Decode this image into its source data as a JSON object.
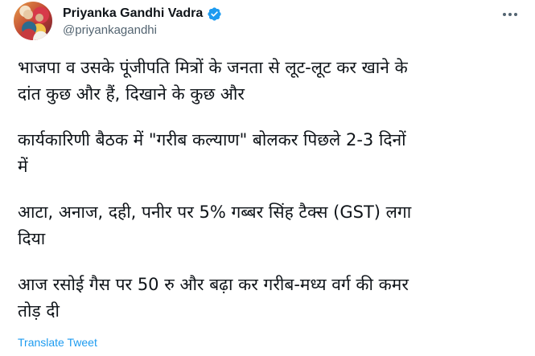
{
  "author": {
    "display_name": "Priyanka Gandhi Vadra",
    "handle": "@priyankagandhi",
    "verified": true,
    "accent_color": "#1d9bf0"
  },
  "tweet": {
    "paragraphs": [
      "भाजपा व उसके पूंजीपति मित्रों के जनता से लूट-लूट कर खाने के\nदांत कुछ और हैं, दिखाने के कुछ और",
      "कार्यकारिणी बैठक में \"गरीब कल्याण\" बोलकर पिछले 2-3 दिनों\nमें",
      "आटा, अनाज, दही, पनीर पर 5% गब्बर सिंह टैक्स (GST) लगा\nदिया",
      "आज रसोई गैस पर 50 रु और बढ़ा कर गरीब-मध्य वर्ग की कमर\nतोड़ दी"
    ],
    "translate_label": "Translate Tweet"
  },
  "icons": {
    "more": "more-horizontal-icon",
    "verified": "verified-badge-icon"
  }
}
